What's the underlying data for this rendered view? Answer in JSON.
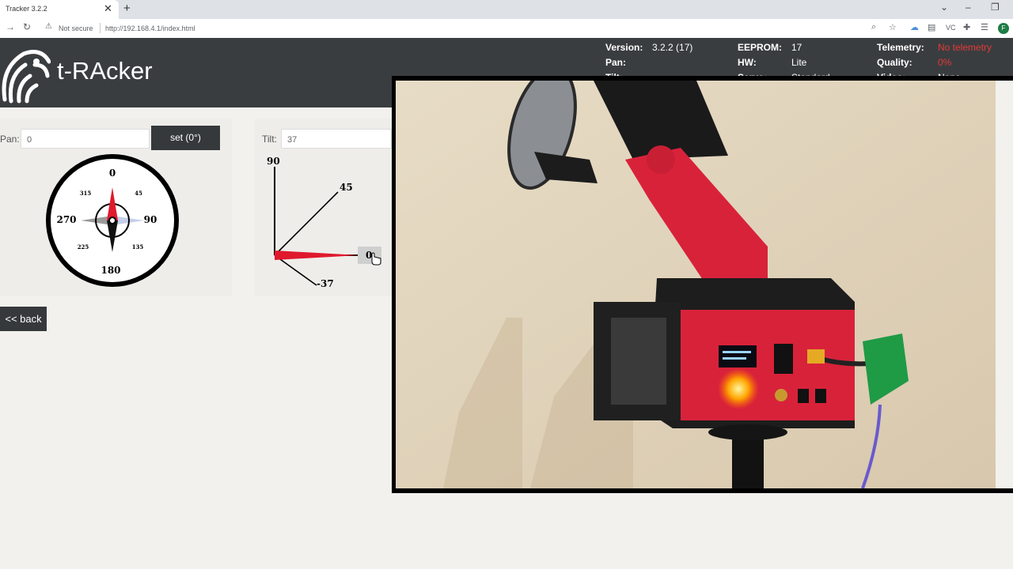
{
  "browser": {
    "tab_title": "Tracker 3.2.2",
    "close_glyph": "✕",
    "new_tab_glyph": "+",
    "not_secure": "Not secure",
    "url": "http://192.168.4.1/index.html",
    "profile_initial": "F"
  },
  "header": {
    "app_title": "t-RAcker",
    "info": {
      "version_label": "Version:",
      "version_value": "3.2.2 (17)",
      "eeprom_label": "EEPROM:",
      "eeprom_value": "17",
      "telemetry_label": "Telemetry:",
      "telemetry_value": "No telemetry",
      "pan_label": "Pan:",
      "hw_label": "HW:",
      "hw_value": "Lite",
      "quality_label": "Quality:",
      "quality_value": "0%",
      "tilt_label": "Tilt:",
      "servo_label": "Servo:",
      "servo_value": "Standard",
      "video_label": "Video:",
      "video_value": "None"
    }
  },
  "pan": {
    "label": "Pan:",
    "value": "0",
    "set_button": "set (0°)",
    "compass": {
      "n": "0",
      "e": "90",
      "s": "180",
      "w": "270",
      "ne": "45",
      "se": "135",
      "sw": "225",
      "nw": "315"
    },
    "heading_deg": 0
  },
  "tilt": {
    "label": "Tilt:",
    "value": "37",
    "marks": {
      "top": "90",
      "diag": "45",
      "zero": "0",
      "neg": "-37"
    },
    "angle_deg": 0
  },
  "back_button": "<< back",
  "colors": {
    "header_bg": "#3a3d40",
    "accent_red": "#e53935",
    "button_bg": "#36393c"
  },
  "icons": [
    "back-arrow-icon",
    "reload-icon",
    "warning-icon",
    "zoom-icon",
    "star-icon",
    "extensions-icon",
    "reading-list-icon",
    "parrot-logo-icon",
    "compass-needle-icon"
  ]
}
